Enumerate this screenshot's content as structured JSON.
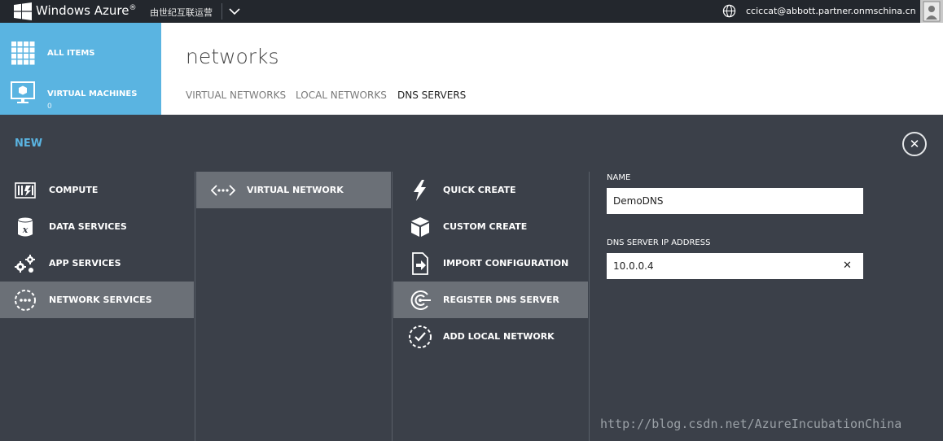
{
  "topbar": {
    "brand": "Windows Azure",
    "brand_mark": "®",
    "operator": "由世纪互联运营",
    "user_email": "cciccat@abbott.partner.onmschina.cn"
  },
  "sidebar": {
    "items": [
      {
        "label": "ALL ITEMS",
        "icon": "grid-icon"
      },
      {
        "label": "VIRTUAL MACHINES",
        "count": "0",
        "icon": "monitor-icon"
      }
    ]
  },
  "header": {
    "title": "networks",
    "tabs": [
      {
        "label": "VIRTUAL NETWORKS",
        "active": false
      },
      {
        "label": "LOCAL NETWORKS",
        "active": false
      },
      {
        "label": "DNS SERVERS",
        "active": true
      }
    ]
  },
  "new_drawer": {
    "title": "NEW",
    "close_symbol": "✕",
    "categories": [
      {
        "label": "COMPUTE",
        "icon": "compute-icon"
      },
      {
        "label": "DATA SERVICES",
        "icon": "database-icon"
      },
      {
        "label": "APP SERVICES",
        "icon": "gears-icon"
      },
      {
        "label": "NETWORK SERVICES",
        "icon": "network-icon",
        "selected": true
      }
    ],
    "subcategories": [
      {
        "label": "VIRTUAL NETWORK",
        "icon": "virtual-network-icon",
        "selected": true
      }
    ],
    "actions": [
      {
        "label": "QUICK CREATE",
        "icon": "lightning-icon"
      },
      {
        "label": "CUSTOM CREATE",
        "icon": "box-icon"
      },
      {
        "label": "IMPORT CONFIGURATION",
        "icon": "import-icon"
      },
      {
        "label": "REGISTER DNS SERVER",
        "icon": "dns-icon",
        "selected": true
      },
      {
        "label": "ADD LOCAL NETWORK",
        "icon": "check-circle-icon"
      }
    ],
    "form": {
      "name_label": "NAME",
      "name_value": "DemoDNS",
      "ip_label": "DNS SERVER IP ADDRESS",
      "ip_value": "10.0.0.4",
      "clear_symbol": "✕"
    }
  },
  "watermark": "http://blog.csdn.net/AzureIncubationChina",
  "colors": {
    "accent_blue": "#5ab4e1",
    "drawer_bg": "#3b4049",
    "selected_bg": "#6b7077",
    "topbar_bg": "#23272d"
  }
}
